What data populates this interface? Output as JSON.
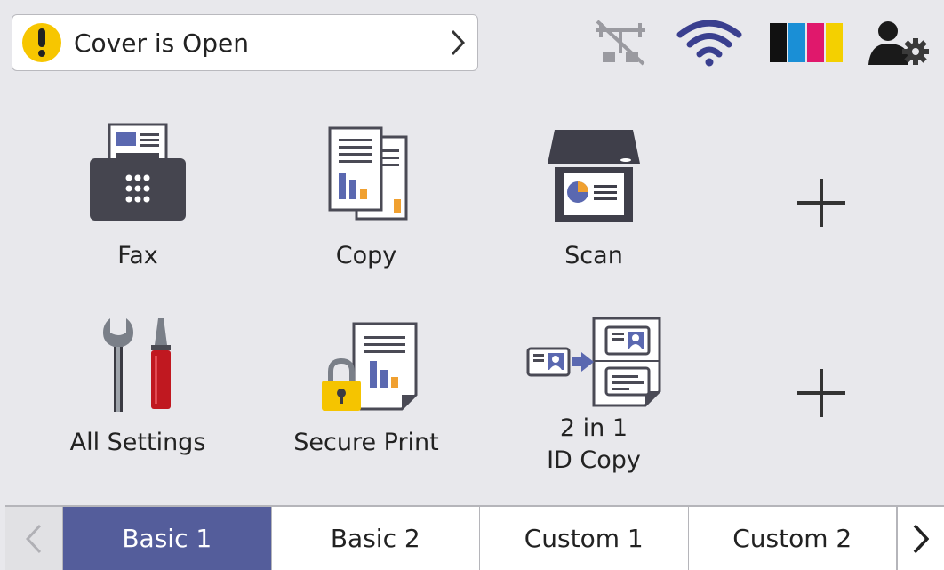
{
  "status": {
    "message": "Cover is Open"
  },
  "tiles": [
    {
      "label": "Fax"
    },
    {
      "label": "Copy"
    },
    {
      "label": "Scan"
    },
    {
      "label": "All Settings"
    },
    {
      "label": "Secure Print"
    },
    {
      "label_line1": "2 in 1",
      "label_line2": "ID Copy"
    }
  ],
  "tabs": [
    "Basic 1",
    "Basic 2",
    "Custom 1",
    "Custom 2"
  ],
  "active_tab": "Basic 1",
  "icons": {
    "status": "warning-icon",
    "wired": "wired-lan-disconnected-icon",
    "wifi": "wifi-icon",
    "ink": "ink-levels-icon",
    "admin": "user-settings-icon"
  },
  "colors": {
    "background": "#e8e8ec",
    "warning": "#f7c600",
    "active_tab": "#545d9b",
    "wifi": "#3a3f8f",
    "ink_black": "#111111",
    "ink_cyan": "#1a8fd6",
    "ink_magenta": "#e0186c",
    "ink_yellow": "#f4d000"
  }
}
